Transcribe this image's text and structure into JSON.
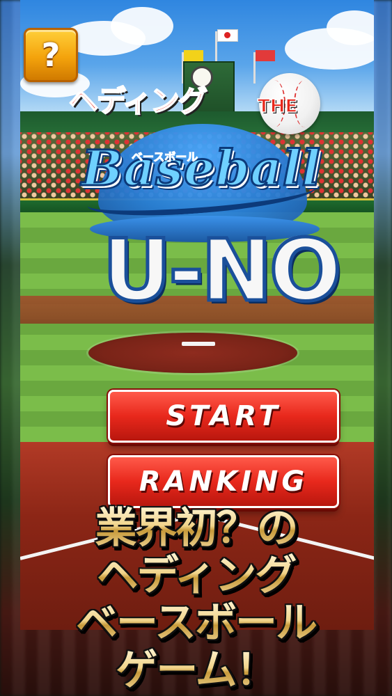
{
  "help": {
    "label": "?"
  },
  "logo": {
    "heading": "ヘディング",
    "the": "THE",
    "baseball": "Baseball",
    "baseball_kana": "ベースボール",
    "uno": "U-NO"
  },
  "menu": {
    "start_label": "START",
    "ranking_label": "RANKING"
  },
  "tagline": {
    "lines": [
      "業界初？の",
      "ヘディング",
      "ベースボール",
      "ゲーム！"
    ]
  },
  "colors": {
    "accent_red": "#e8281c",
    "logo_blue": "#1a4f9a",
    "help_yellow": "#f4a30c",
    "tagline_gold": "#f1d48a"
  }
}
